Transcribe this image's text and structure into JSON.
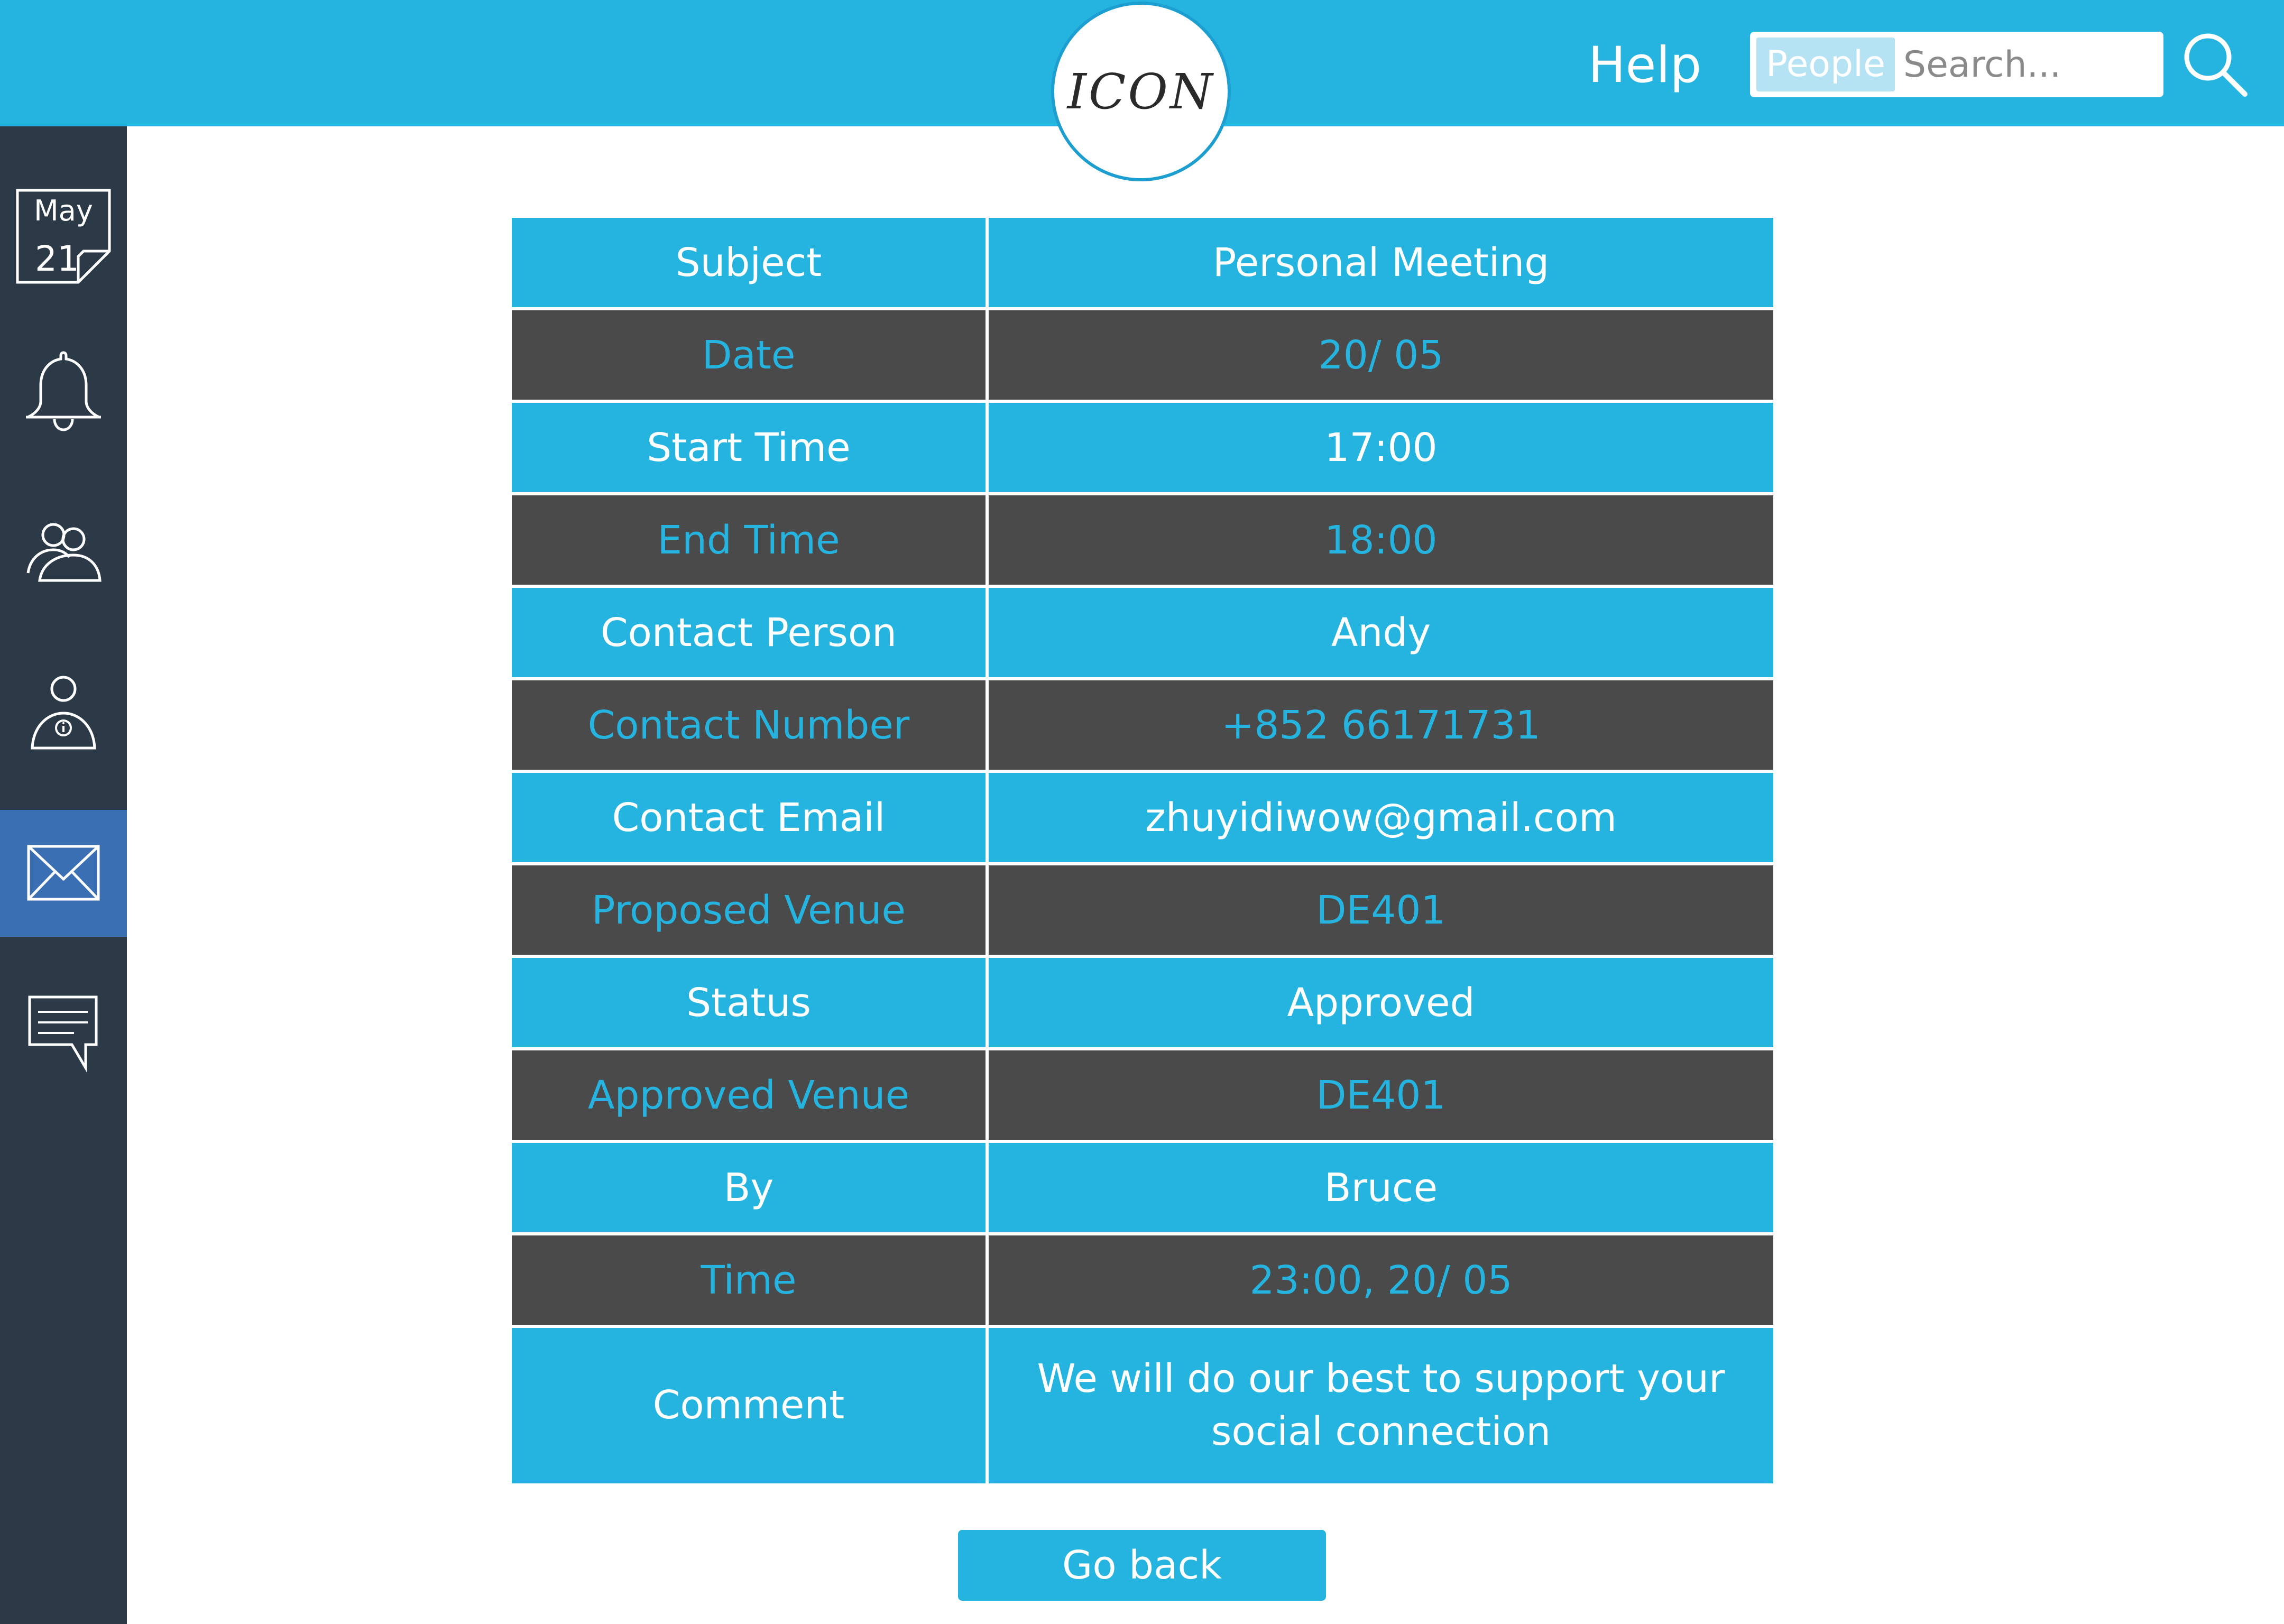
{
  "header": {
    "logo_text": "ICON",
    "help_label": "Help",
    "search": {
      "scope_label": "People",
      "placeholder": "Search..."
    },
    "search_icon": "search-icon"
  },
  "sidebar": {
    "calendar": {
      "month": "May",
      "day": "21",
      "icon": "calendar-icon"
    },
    "items": [
      {
        "icon": "bell-icon"
      },
      {
        "icon": "people-icon"
      },
      {
        "icon": "user-info-icon"
      },
      {
        "icon": "mail-icon",
        "active": true
      },
      {
        "icon": "comment-icon"
      }
    ]
  },
  "details": {
    "rows": [
      {
        "label": "Subject",
        "value": "Personal Meeting"
      },
      {
        "label": "Date",
        "value": "20/ 05"
      },
      {
        "label": "Start Time",
        "value": "17:00"
      },
      {
        "label": "End Time",
        "value": "18:00"
      },
      {
        "label": "Contact Person",
        "value": "Andy"
      },
      {
        "label": "Contact Number",
        "value": "+852 66171731"
      },
      {
        "label": "Contact Email",
        "value": "zhuyidiwow@gmail.com"
      },
      {
        "label": "Proposed Venue",
        "value": "DE401"
      },
      {
        "label": "Status",
        "value": "Approved"
      },
      {
        "label": "Approved Venue",
        "value": "DE401"
      },
      {
        "label": "By",
        "value": "Bruce"
      },
      {
        "label": "Time",
        "value": "23:00, 20/ 05"
      },
      {
        "label": "Comment",
        "value": "We will do our best to support your social connection"
      }
    ]
  },
  "actions": {
    "go_back_label": "Go back"
  },
  "colors": {
    "accent": "#25b4e0",
    "sidebar": "#2c3a47",
    "sidebar_active": "#3b6fb4",
    "dark_row": "#4a4a4a"
  }
}
